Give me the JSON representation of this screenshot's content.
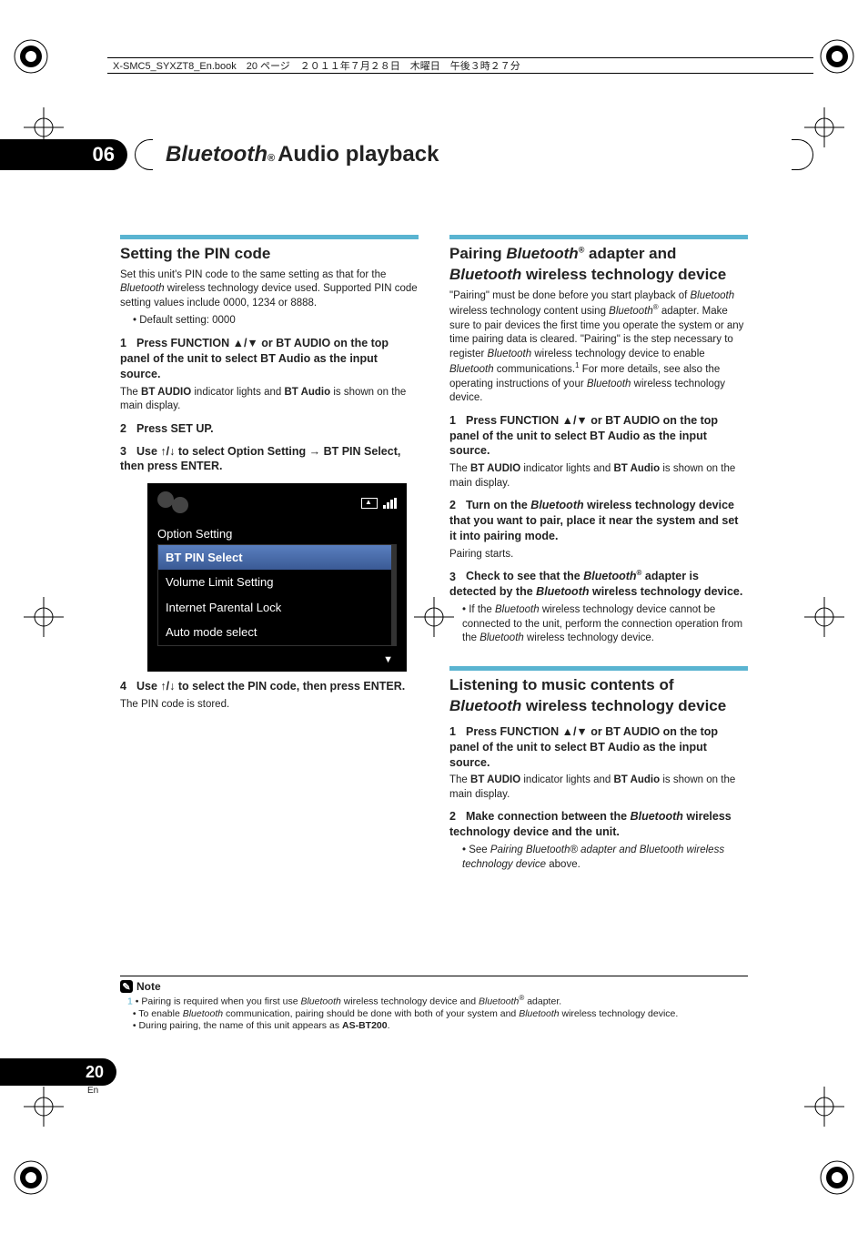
{
  "filebar": "X-SMC5_SYXZT8_En.book　20 ページ　２０１１年７月２８日　木曜日　午後３時２７分",
  "chapter": {
    "num": "06",
    "bt": "Bluetooth",
    "sup": "®",
    "rest": " Audio playback"
  },
  "left": {
    "h2": "Setting the PIN code",
    "intro_a": "Set this unit's PIN code to the same setting as that for the ",
    "intro_b": "Bluetooth",
    "intro_c": " wireless technology device used. Supported PIN code setting values include 0000, 1234 or 8888.",
    "bullet1": "Default setting: 0000",
    "s1_num": "1",
    "s1": "Press FUNCTION ▲/▼ or BT AUDIO on the top panel of the unit to select BT Audio as the input source.",
    "s1_sub_a": "The ",
    "s1_sub_b": "BT AUDIO",
    "s1_sub_c": " indicator lights and ",
    "s1_sub_d": "BT Audio",
    "s1_sub_e": " is shown on the main display.",
    "s2_num": "2",
    "s2": "Press SET UP.",
    "s3_num": "3",
    "s3": "Use ↑/↓ to select Option Setting → BT PIN Select, then press ENTER.",
    "osd": {
      "header": "Option Setting",
      "items": [
        "BT PIN Select",
        "Volume Limit Setting",
        "Internet Parental Lock",
        "Auto mode select"
      ],
      "selected_index": 0
    },
    "s4_num": "4",
    "s4": "Use ↑/↓ to select the PIN code, then press ENTER.",
    "s4_sub": "The PIN code is stored."
  },
  "right": {
    "h2_a": "Pairing ",
    "h2_b": "Bluetooth",
    "h2_sup": "®",
    "h2_c": " adapter and ",
    "h2_d": "Bluetooth",
    "h2_e": " wireless technology device",
    "p1_a": "\"Pairing\" must be done before you start playback of ",
    "p1_b": "Bluetooth",
    "p1_c": " wireless technology content using ",
    "p1_d": "Bluetooth",
    "p1_sup": "®",
    "p1_e": " adapter. Make sure to pair devices the first time you operate the system or any time pairing data is cleared. \"Pairing\" is the step necessary to register ",
    "p1_f": "Bluetooth",
    "p1_g": " wireless technology device to enable ",
    "p1_h": "Bluetooth",
    "p1_i": " communications.",
    "p1_ref": "1",
    "p1_j": " For more details, see also the operating instructions of your ",
    "p1_k": "Bluetooth",
    "p1_l": " wireless technology device.",
    "r_s1_num": "1",
    "r_s1": "Press FUNCTION ▲/▼ or BT AUDIO on the top panel of the unit to select BT Audio as the input source.",
    "r_s1_sub_a": "The ",
    "r_s1_sub_b": "BT AUDIO",
    "r_s1_sub_c": " indicator lights and ",
    "r_s1_sub_d": "BT Audio",
    "r_s1_sub_e": " is shown on the main display.",
    "r_s2_num": "2",
    "r_s2_a": "Turn on the ",
    "r_s2_b": "Bluetooth",
    "r_s2_c": " wireless technology device that you want to pair, place it near the system and set it into pairing mode.",
    "r_s2_sub": "Pairing starts.",
    "r_s3_num": "3",
    "r_s3_a": "Check to see that the ",
    "r_s3_b": "Bluetooth",
    "r_s3_sup": "®",
    "r_s3_c": " adapter is detected by the ",
    "r_s3_d": "Bluetooth",
    "r_s3_e": " wireless technology device.",
    "r_s3_bul_a": "If the ",
    "r_s3_bul_b": "Bluetooth",
    "r_s3_bul_c": " wireless technology device cannot be connected to the unit, perform the connection operation from the ",
    "r_s3_bul_d": "Bluetooth",
    "r_s3_bul_e": " wireless technology device.",
    "h3_a": "Listening to music contents of ",
    "h3_b": "Bluetooth",
    "h3_c": " wireless technology device",
    "l_s1_num": "1",
    "l_s1": "Press FUNCTION ▲/▼ or BT AUDIO on the top panel of the unit to select BT Audio as the input source.",
    "l_s1_sub_a": "The ",
    "l_s1_sub_b": "BT AUDIO",
    "l_s1_sub_c": " indicator lights and ",
    "l_s1_sub_d": "BT Audio",
    "l_s1_sub_e": " is shown on the main display.",
    "l_s2_num": "2",
    "l_s2_a": "Make connection between the ",
    "l_s2_b": "Bluetooth",
    "l_s2_c": " wireless technology device and the unit.",
    "l_s2_bul_a": "See ",
    "l_s2_bul_b": "Pairing Bluetooth® adapter and Bluetooth wireless technology device",
    "l_s2_bul_c": " above."
  },
  "note": {
    "label": "Note",
    "ref": "1",
    "n1_a": "Pairing is required when you first use ",
    "n1_b": "Bluetooth",
    "n1_c": " wireless technology device and ",
    "n1_d": "Bluetooth",
    "n1_sup": "®",
    "n1_e": " adapter.",
    "n2_a": "To enable ",
    "n2_b": "Bluetooth",
    "n2_c": " communication, pairing should be done with both of your system and ",
    "n2_d": "Bluetooth",
    "n2_e": " wireless technology device.",
    "n3_a": "During pairing, the name of this unit appears as ",
    "n3_b": "AS-BT200",
    "n3_c": "."
  },
  "page": {
    "num": "20",
    "lang": "En"
  }
}
